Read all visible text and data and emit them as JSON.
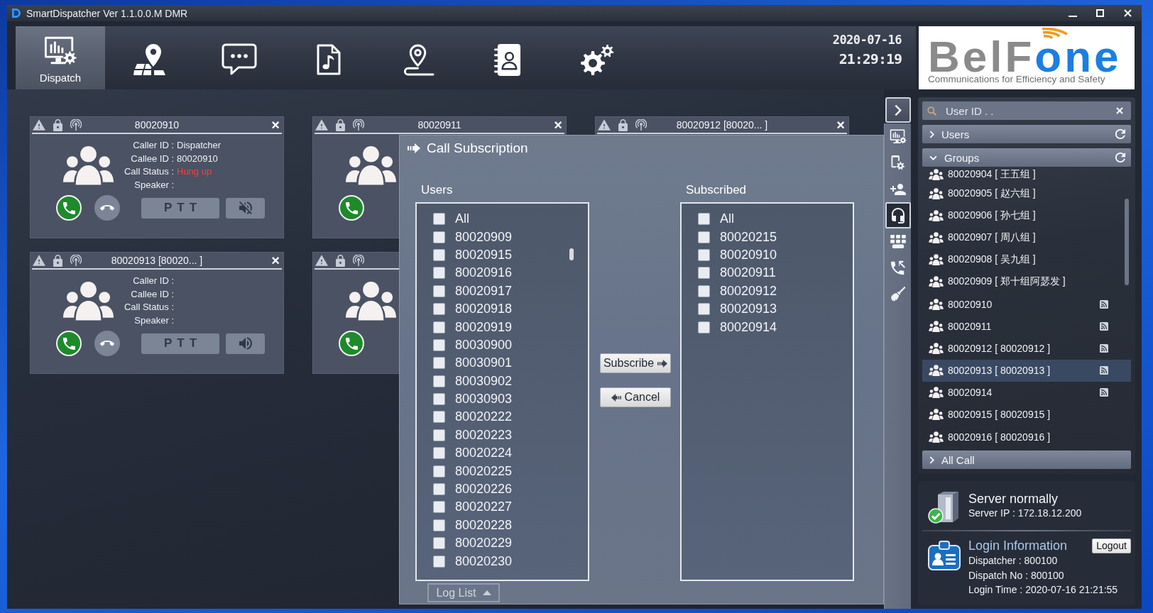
{
  "window": {
    "title": "SmartDispatcher Ver 1.1.0.0.M DMR"
  },
  "toolbar": {
    "tabs": [
      {
        "label": "Dispatch",
        "selected": true
      },
      {
        "selected": false
      },
      {
        "selected": false
      },
      {
        "selected": false
      },
      {
        "selected": false
      },
      {
        "selected": false
      },
      {
        "selected": false
      }
    ],
    "date": "2020-07-16",
    "time": "21:29:19"
  },
  "logo": {
    "wordmark": [
      "BelF",
      "one"
    ],
    "tagline": "Communications for Efficiency and Safety"
  },
  "call_cards": [
    {
      "kind": "full",
      "title": "80020910",
      "close": "×",
      "fields": [
        {
          "label": "Caller ID :",
          "value": "Dispatcher",
          "alert": false
        },
        {
          "label": "Callee ID :",
          "value": "80020910",
          "alert": false
        },
        {
          "label": "Call Status :",
          "value": "Hung up",
          "alert": true
        },
        {
          "label": "Speaker :"
        }
      ],
      "controls": [
        {
          "kind": "answer"
        },
        {
          "kind": "hangup"
        },
        {
          "kind": "ptt",
          "label": "PTT"
        },
        {
          "kind": "speaker",
          "muted": true
        }
      ]
    },
    {
      "kind": "full",
      "title": "80020911",
      "close": "×",
      "controls": [
        {
          "kind": "answer"
        }
      ]
    },
    {
      "kind": "header",
      "title": "80020912 [80020... ]",
      "close": "×"
    },
    {
      "kind": "full",
      "title": "80020913 [80020... ]",
      "close": "×",
      "fields": [
        {
          "label": "Caller ID :"
        },
        {
          "label": "Callee ID :"
        },
        {
          "label": "Call Status :"
        },
        {
          "label": "Speaker :"
        }
      ],
      "controls": [
        {
          "kind": "answer"
        },
        {
          "kind": "hangup"
        },
        {
          "kind": "ptt",
          "label": "PTT"
        },
        {
          "kind": "speaker",
          "muted": false
        }
      ]
    },
    {
      "kind": "full",
      "controls": [
        {
          "kind": "answer"
        }
      ]
    }
  ],
  "subscription_dialog": {
    "title": "Call Subscription",
    "users_label": "Users",
    "users": [
      {
        "label": "All",
        "checked": false
      },
      {
        "label": "80020909",
        "checked": false
      },
      {
        "label": "80020915",
        "checked": false
      },
      {
        "label": "80020916",
        "checked": false
      },
      {
        "label": "80020917",
        "checked": false
      },
      {
        "label": "80020918",
        "checked": false
      },
      {
        "label": "80020919",
        "checked": false
      },
      {
        "label": "80030900",
        "checked": false
      },
      {
        "label": "80030901",
        "checked": false
      },
      {
        "label": "80030902",
        "checked": false
      },
      {
        "label": "80030903",
        "checked": false
      },
      {
        "label": "80020222",
        "checked": false
      },
      {
        "label": "80020223",
        "checked": false
      },
      {
        "label": "80020224",
        "checked": false
      },
      {
        "label": "80020225",
        "checked": false
      },
      {
        "label": "80020226",
        "checked": false
      },
      {
        "label": "80020227",
        "checked": false
      },
      {
        "label": "80020228",
        "checked": false
      },
      {
        "label": "80020229",
        "checked": false
      },
      {
        "label": "80020230",
        "checked": false
      }
    ],
    "subscribed_label": "Subscribed",
    "subscribed": [
      {
        "label": "All",
        "checked": false
      },
      {
        "label": "80020215",
        "checked": false
      },
      {
        "label": "80020910",
        "checked": false
      },
      {
        "label": "80020911",
        "checked": false
      },
      {
        "label": "80020912",
        "checked": false
      },
      {
        "label": "80020913",
        "checked": false
      },
      {
        "label": "80020914",
        "checked": false
      }
    ],
    "subscribe_button": "Subscribe",
    "cancel_button": "Cancel"
  },
  "log_list": {
    "label": "Log List"
  },
  "side_tools": [
    {
      "selected": false
    },
    {
      "selected": false
    },
    {
      "selected": false
    },
    {
      "selected": true
    },
    {
      "selected": false
    },
    {
      "selected": false
    },
    {
      "selected": false
    }
  ],
  "directory": {
    "search": {
      "placeholder": "User ID . ."
    },
    "sections": [
      {
        "title": "Users",
        "expanded": false,
        "refreshable": true
      },
      {
        "title": "Groups",
        "expanded": true,
        "refreshable": true,
        "items": [
          {
            "label": "80020904 [ 王五组 ]",
            "subscribed": false,
            "selected": false
          },
          {
            "label": "80020905 [ 赵六组 ]",
            "subscribed": false,
            "selected": false
          },
          {
            "label": "80020906 [ 孙七组 ]",
            "subscribed": false,
            "selected": false
          },
          {
            "label": "80020907 [ 周八组 ]",
            "subscribed": false,
            "selected": false
          },
          {
            "label": "80020908 [ 吴九组 ]",
            "subscribed": false,
            "selected": false
          },
          {
            "label": "80020909 [ 郑十组阿瑟发 ]",
            "subscribed": false,
            "selected": false
          },
          {
            "label": "80020910",
            "subscribed": true,
            "selected": false
          },
          {
            "label": "80020911",
            "subscribed": true,
            "selected": false
          },
          {
            "label": "80020912 [ 80020912 ]",
            "subscribed": true,
            "selected": false
          },
          {
            "label": "80020913 [ 80020913 ]",
            "subscribed": true,
            "selected": true
          },
          {
            "label": "80020914",
            "subscribed": true,
            "selected": false
          },
          {
            "label": "80020915 [ 80020915 ]",
            "subscribed": false,
            "selected": false
          },
          {
            "label": "80020916 [ 80020916 ]",
            "subscribed": false,
            "selected": false
          }
        ]
      },
      {
        "title": "All Call",
        "expanded": false,
        "refreshable": false
      }
    ]
  },
  "server": {
    "status": "Server normally",
    "ip": "Server IP : 172.18.12.200"
  },
  "login": {
    "title": "Login Information",
    "logout_button": "Logout",
    "lines": [
      "Dispatcher : 800100",
      "Dispatch No : 800100",
      "Login Time : 2020-07-16 21:21:55"
    ]
  }
}
